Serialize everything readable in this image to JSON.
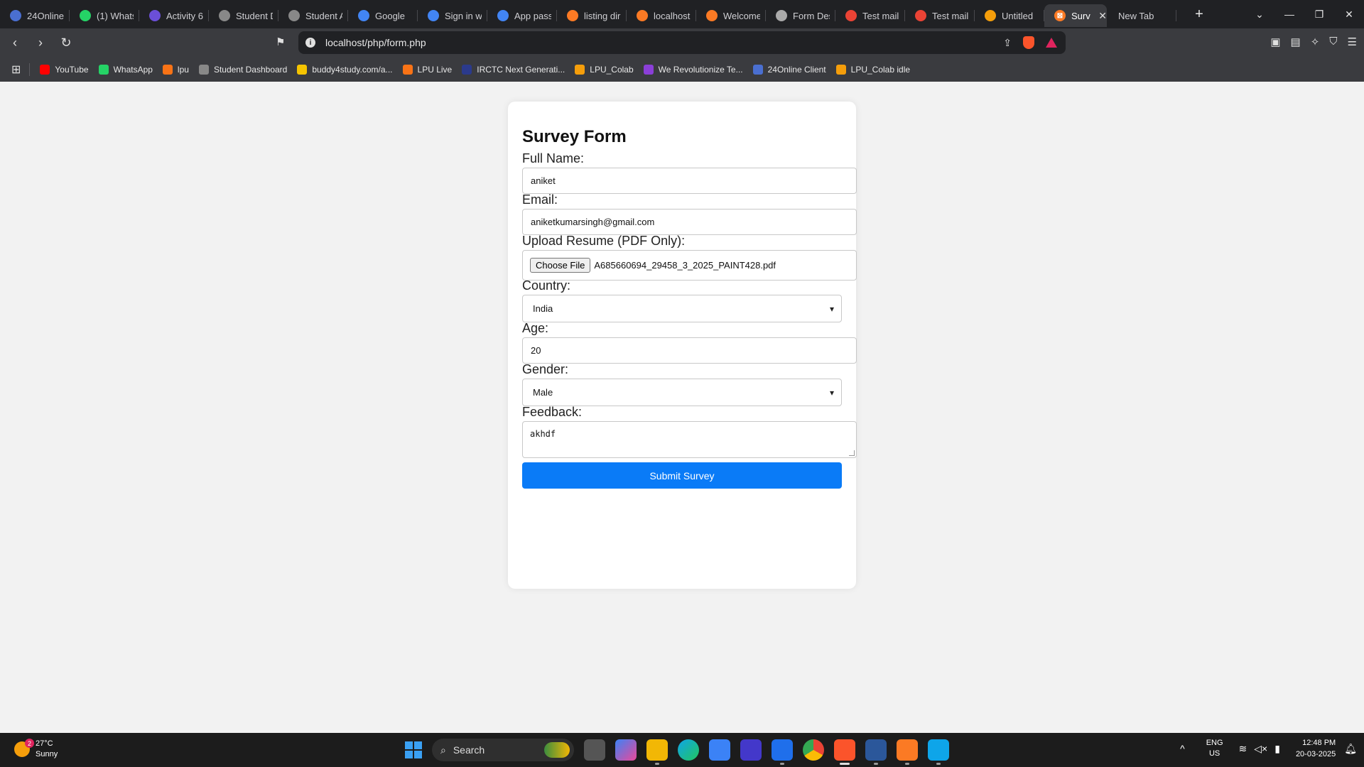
{
  "browser": {
    "tabs": [
      {
        "label": "24Online",
        "color": "#4a6fd1"
      },
      {
        "label": "(1) Whats",
        "color": "#25d366"
      },
      {
        "label": "Activity 6",
        "color": "#6b4fd8"
      },
      {
        "label": "Student D",
        "color": "#888888"
      },
      {
        "label": "Student A",
        "color": "#888888"
      },
      {
        "label": "Google",
        "color": "#4285f4"
      },
      {
        "label": "Sign in w",
        "color": "#4285f4"
      },
      {
        "label": "App pass",
        "color": "#4285f4"
      },
      {
        "label": "listing dir",
        "color": "#fb7a24"
      },
      {
        "label": "localhost",
        "color": "#fb7a24"
      },
      {
        "label": "Welcome",
        "color": "#fb7a24"
      },
      {
        "label": "Form Des",
        "color": "#aaaaaa"
      },
      {
        "label": "Test mail",
        "color": "#ea4335"
      },
      {
        "label": "Test mail",
        "color": "#ea4335"
      },
      {
        "label": "Untitled",
        "color": "#f59e0b"
      }
    ],
    "active_tab": {
      "label": "Surv",
      "color": "#fb7a24"
    },
    "new_tab": {
      "label": "New Tab"
    },
    "url": "localhost/php/form.php",
    "bookmarks": [
      {
        "label": "YouTube",
        "color": "#ff0000"
      },
      {
        "label": "WhatsApp",
        "color": "#25d366"
      },
      {
        "label": "lpu",
        "color": "#f97316"
      },
      {
        "label": "Student Dashboard",
        "color": "#888888"
      },
      {
        "label": "buddy4study.com/a...",
        "color": "#f5c400"
      },
      {
        "label": "LPU Live",
        "color": "#f97316"
      },
      {
        "label": "IRCTC Next Generati...",
        "color": "#2b3a8c"
      },
      {
        "label": "LPU_Colab",
        "color": "#f59e0b"
      },
      {
        "label": "We Revolutionize Te...",
        "color": "#8b3fd8"
      },
      {
        "label": "24Online Client",
        "color": "#4a6fd1"
      },
      {
        "label": "LPU_Colab idle",
        "color": "#f59e0b"
      }
    ]
  },
  "form": {
    "title": "Survey Form",
    "full_name": {
      "label": "Full Name:",
      "value": "aniket"
    },
    "email": {
      "label": "Email:",
      "value": "aniketkumarsingh@gmail.com"
    },
    "resume": {
      "label": "Upload Resume (PDF Only):",
      "button": "Choose File",
      "filename": "A685660694_29458_3_2025_PAINT428.pdf"
    },
    "country": {
      "label": "Country:",
      "value": "India"
    },
    "age": {
      "label": "Age:",
      "value": "20"
    },
    "gender": {
      "label": "Gender:",
      "value": "Male"
    },
    "feedback": {
      "label": "Feedback:",
      "value": "akhdf"
    },
    "submit_label": "Submit Survey",
    "accent": "#0a7bf7"
  },
  "taskbar": {
    "weather": {
      "temp": "27°C",
      "condition": "Sunny",
      "badge": "2"
    },
    "search_label": "Search",
    "lang": {
      "line1": "ENG",
      "line2": "US"
    },
    "clock": {
      "time": "12:48 PM",
      "date": "20-03-2025"
    }
  }
}
